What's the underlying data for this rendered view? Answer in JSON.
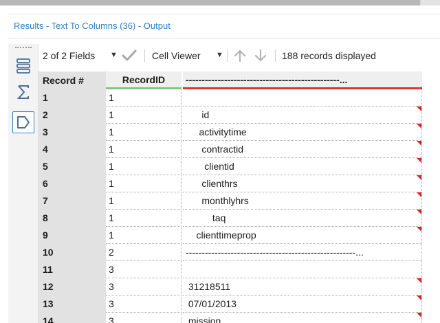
{
  "window": {
    "title": "Results - Text To Columns (36) - Output"
  },
  "toolbar": {
    "fields_label": "2 of 2 Fields",
    "viewer_label": "Cell Viewer",
    "records_label": "188 records displayed"
  },
  "grid": {
    "headers": {
      "record": "Record #",
      "recordid": "RecordID",
      "column2": "------------------------------------------------..."
    },
    "rows": [
      {
        "rec": "1",
        "rid": "1",
        "val": "",
        "flag": false
      },
      {
        "rec": "2",
        "rid": "1",
        "val": "      id",
        "flag": true
      },
      {
        "rec": "3",
        "rid": "1",
        "val": "     activitytime",
        "flag": true
      },
      {
        "rec": "4",
        "rid": "1",
        "val": "      contractid",
        "flag": true
      },
      {
        "rec": "5",
        "rid": "1",
        "val": "       clientid",
        "flag": true
      },
      {
        "rec": "6",
        "rid": "1",
        "val": "      clienthrs",
        "flag": true
      },
      {
        "rec": "7",
        "rid": "1",
        "val": "      monthlyhrs",
        "flag": true
      },
      {
        "rec": "8",
        "rid": "1",
        "val": "          taq",
        "flag": true
      },
      {
        "rec": "9",
        "rid": "1",
        "val": "    clienttimeprop",
        "flag": true
      },
      {
        "rec": "10",
        "rid": "2",
        "val": "-----------------------------------------------------...",
        "flag": false
      },
      {
        "rec": "11",
        "rid": "3",
        "val": "",
        "flag": false
      },
      {
        "rec": "12",
        "rid": "3",
        "val": " 31218511",
        "flag": true
      },
      {
        "rec": "13",
        "rid": "3",
        "val": " 07/01/2013",
        "flag": true
      },
      {
        "rec": "14",
        "rid": "3",
        "val": " mission",
        "flag": true
      }
    ]
  },
  "colors": {
    "accent": "#2f7ebf",
    "recordid_underline": "#7ec97e",
    "column_underline": "#e33232",
    "flag": "#e02020"
  },
  "icons": [
    "table-view-icon",
    "sigma-summary-icon",
    "tag-shape-icon",
    "checkmark-icon",
    "arrow-up-icon",
    "arrow-down-icon",
    "dropdown-caret-icon"
  ]
}
